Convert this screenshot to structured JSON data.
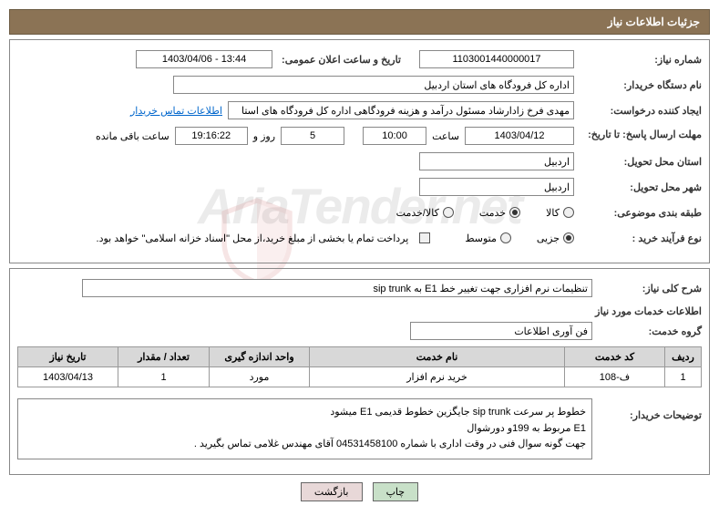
{
  "header_title": "جزئیات اطلاعات نیاز",
  "fields": {
    "need_number_label": "شماره نیاز:",
    "need_number_value": "1103001440000017",
    "announce_date_label": "تاریخ و ساعت اعلان عمومی:",
    "announce_date_value": "1403/04/06 - 13:44",
    "buyer_org_label": "نام دستگاه خریدار:",
    "buyer_org_value": "اداره کل فرودگاه های استان اردبیل",
    "requester_label": "ایجاد کننده درخواست:",
    "requester_value": "مهدی فرخ زادارشاد مسئول درآمد و هزینه فرودگاهی اداره کل فرودگاه های استا",
    "contact_link": "اطلاعات تماس خریدار",
    "deadline_label": "مهلت ارسال پاسخ: تا تاریخ:",
    "deadline_date": "1403/04/12",
    "deadline_hour_label": "ساعت",
    "deadline_hour": "10:00",
    "days_value": "5",
    "days_label": "روز و",
    "time_remaining": "19:16:22",
    "remaining_label": "ساعت باقی مانده",
    "delivery_province_label": "استان محل تحویل:",
    "delivery_province_value": "اردبیل",
    "delivery_city_label": "شهر محل تحویل:",
    "delivery_city_value": "اردبیل",
    "category_label": "طبقه بندی موضوعی:",
    "cat_goods": "کالا",
    "cat_service": "خدمت",
    "cat_goods_service": "کالا/خدمت",
    "purchase_type_label": "نوع فرآیند خرید :",
    "type_partial": "جزیی",
    "type_medium": "متوسط",
    "treasury_note": "پرداخت تمام یا بخشی از مبلغ خرید،از محل \"اسناد خزانه اسلامی\" خواهد بود.",
    "general_desc_label": "شرح کلی نیاز:",
    "general_desc_value": "تنظیمات نرم افزاری جهت تغییر خط E1 به sip trunk",
    "services_info_label": "اطلاعات خدمات مورد نیاز",
    "service_group_label": "گروه خدمت:",
    "service_group_value": "فن آوری اطلاعات"
  },
  "table": {
    "headers": [
      "ردیف",
      "کد خدمت",
      "نام خدمت",
      "واحد اندازه گیری",
      "تعداد / مقدار",
      "تاریخ نیاز"
    ],
    "rows": [
      {
        "row": "1",
        "code": "ف-108",
        "name": "خرید نرم افزار",
        "unit": "مورد",
        "qty": "1",
        "date": "1403/04/13"
      }
    ]
  },
  "buyer_notes": {
    "label": "توضیحات خریدار:",
    "line1": "خطوط پر سرعت sip trunk جایگزین خطوط قدیمی E1 میشود",
    "line2": "E1 مربوط به 199و دورشوال",
    "line3": "جهت گونه سوال فنی در وقت اداری با شماره 04531458100 آقای مهندس غلامی تماس بگیرید ."
  },
  "buttons": {
    "print": "چاپ",
    "back": "بازگشت"
  },
  "watermark": "AriaTender.net"
}
